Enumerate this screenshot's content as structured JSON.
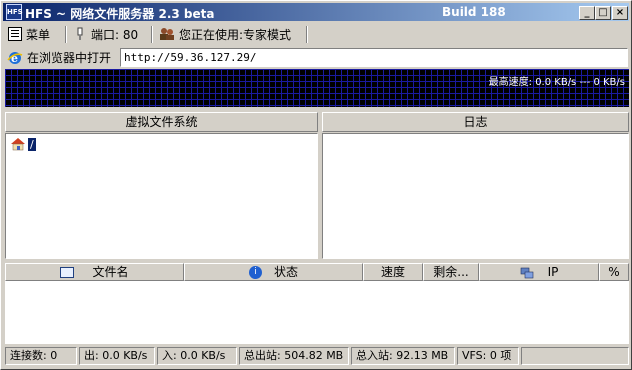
{
  "window": {
    "title": "HFS ~ 网络文件服务器 2.3 beta",
    "build": "Build 188",
    "logo_text": "HFS",
    "minimize": "_",
    "maximize": "□",
    "close": "×"
  },
  "toolbar": {
    "menu_label": "菜单",
    "port_label": "端口: 80",
    "mode_label": "您正在使用:专家模式"
  },
  "url_bar": {
    "open_in_browser_label": "在浏览器中打开",
    "url": "http://59.36.127.29/"
  },
  "graph": {
    "speed_text": "最高速度: 0.0 KB/s --- 0 KB/s"
  },
  "vfs": {
    "header": "虚拟文件系统",
    "root_label": "/"
  },
  "log": {
    "header": "日志"
  },
  "transfers": {
    "columns": {
      "filename": "文件名",
      "status": "状态",
      "speed": "速度",
      "remaining": "剩余...",
      "ip": "IP",
      "percent": "%"
    }
  },
  "statusbar": {
    "connections": "连接数: 0",
    "out": "出: 0.0 KB/s",
    "in": "入: 0.0 KB/s",
    "total_out": "总出站: 504.82 MB",
    "total_in": "总入站: 92.13 MB",
    "vfs": "VFS: 0 项"
  },
  "colors": {
    "title_start": "#0a246a",
    "title_end": "#a6caf0",
    "graph_bg": "#000000",
    "graph_grid": "#1a1aa0"
  }
}
